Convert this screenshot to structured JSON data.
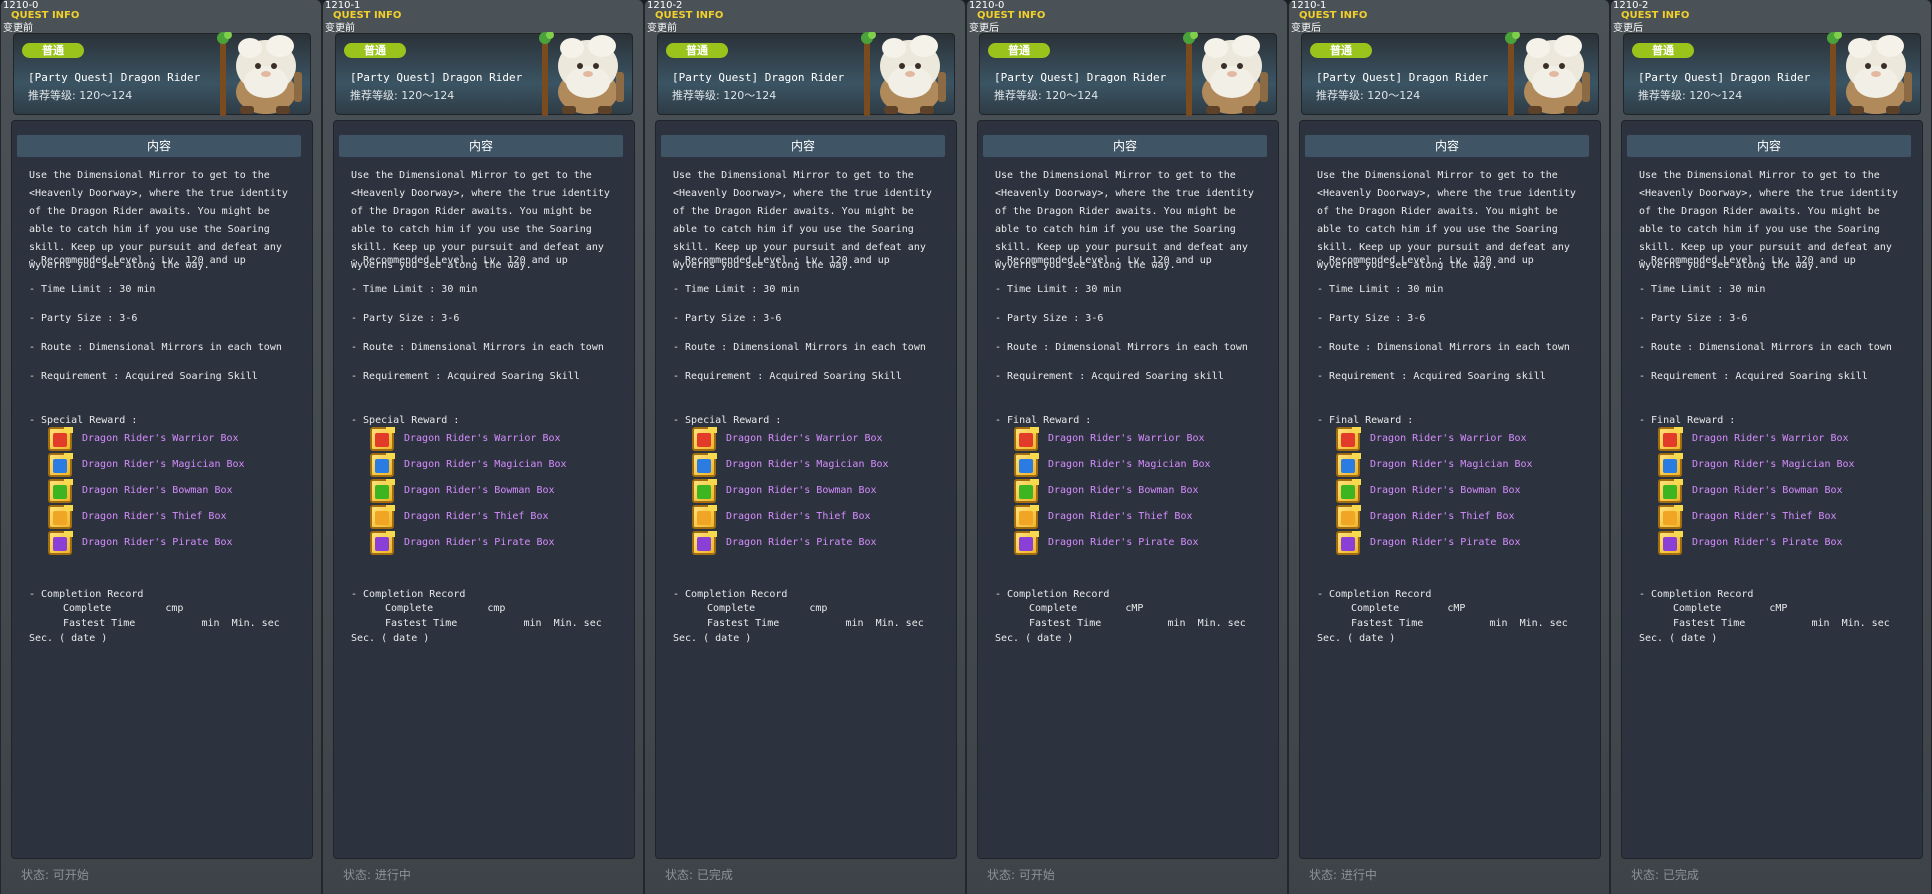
{
  "colors": {
    "panel_bg": "#454b50",
    "content_bg": "#2d333e",
    "content_header_bg": "#3f5566",
    "badge_bg": "#9ac41c",
    "title_yellow": "#f2d02c",
    "reward_link": "#d58cff",
    "status_text": "#8a9298",
    "box_warrior": "#e23b2a",
    "box_magician": "#2a7be2",
    "box_bowman": "#3cb521",
    "box_thief": "#f0a624",
    "box_pirate": "#8a3fd6"
  },
  "panels": [
    {
      "id": "1210-0",
      "title": "QUEST INFO",
      "subtitle": "变更前",
      "badge": "普通",
      "quest_name": "[Party Quest] Dragon Rider",
      "level": "推荐等级: 120～124",
      "section_header": "内容",
      "description": "Use the Dimensional Mirror to get to the\n<Heavenly Doorway>, where the true identity\nof the Dragon Rider awaits. You might be\nable to catch him if you use the Soaring\nskill. Keep up your pursuit and defeat any\nWyverns you see along the way.",
      "recommended_level": "- Recommended Level : Lv. 120 and up",
      "time_limit": "- Time Limit : 30 min",
      "party_size": "- Party Size : 3-6",
      "route": "- Route : Dimensional Mirrors in each town",
      "requirement": "- Requirement : Acquired Soaring Skill",
      "reward_heading": "- Special Reward :",
      "rewards": [
        {
          "icon": "warrior-box-icon",
          "label": "Dragon Rider's Warrior Box"
        },
        {
          "icon": "magician-box-icon",
          "label": "Dragon Rider's Magician Box"
        },
        {
          "icon": "bowman-box-icon",
          "label": "Dragon Rider's Bowman Box"
        },
        {
          "icon": "thief-box-icon",
          "label": "Dragon Rider's Thief Box"
        },
        {
          "icon": "pirate-box-icon",
          "label": "Dragon Rider's Pirate Box"
        }
      ],
      "record_heading": "- Completion Record",
      "record_complete": "Complete         cmp",
      "record_fastest": "Fastest Time           min  Min. sec",
      "record_date": "Sec. ( date )",
      "status": "状态:  可开始"
    },
    {
      "id": "1210-1",
      "title": "QUEST INFO",
      "subtitle": "变更前",
      "badge": "普通",
      "quest_name": "[Party Quest] Dragon Rider",
      "level": "推荐等级: 120～124",
      "section_header": "内容",
      "description": "Use the Dimensional Mirror to get to the\n<Heavenly Doorway>, where the true identity\nof the Dragon Rider awaits. You might be\nable to catch him if you use the Soaring\nskill. Keep up your pursuit and defeat any\nWyverns you see along the way.",
      "recommended_level": "- Recommended Level : Lv. 120 and up",
      "time_limit": "- Time Limit : 30 min",
      "party_size": "- Party Size : 3-6",
      "route": "- Route : Dimensional Mirrors in each town",
      "requirement": "- Requirement : Acquired Soaring Skill",
      "reward_heading": "- Special Reward :",
      "rewards": [
        {
          "icon": "warrior-box-icon",
          "label": "Dragon Rider's Warrior Box"
        },
        {
          "icon": "magician-box-icon",
          "label": "Dragon Rider's Magician Box"
        },
        {
          "icon": "bowman-box-icon",
          "label": "Dragon Rider's Bowman Box"
        },
        {
          "icon": "thief-box-icon",
          "label": "Dragon Rider's Thief Box"
        },
        {
          "icon": "pirate-box-icon",
          "label": "Dragon Rider's Pirate Box"
        }
      ],
      "record_heading": "- Completion Record",
      "record_complete": "Complete         cmp",
      "record_fastest": "Fastest Time           min  Min. sec",
      "record_date": "Sec. ( date )",
      "status": "状态:  进行中"
    },
    {
      "id": "1210-2",
      "title": "QUEST INFO",
      "subtitle": "变更前",
      "badge": "普通",
      "quest_name": "[Party Quest] Dragon Rider",
      "level": "推荐等级: 120～124",
      "section_header": "内容",
      "description": "Use the Dimensional Mirror to get to the\n<Heavenly Doorway>, where the true identity\nof the Dragon Rider awaits. You might be\nable to catch him if you use the Soaring\nskill. Keep up your pursuit and defeat any\nWyverns you see along the way.",
      "recommended_level": "- Recommended Level : Lv. 120 and up",
      "time_limit": "- Time Limit : 30 min",
      "party_size": "- Party Size : 3-6",
      "route": "- Route : Dimensional Mirrors in each town",
      "requirement": "- Requirement : Acquired Soaring Skill",
      "reward_heading": "- Special Reward :",
      "rewards": [
        {
          "icon": "warrior-box-icon",
          "label": "Dragon Rider's Warrior Box"
        },
        {
          "icon": "magician-box-icon",
          "label": "Dragon Rider's Magician Box"
        },
        {
          "icon": "bowman-box-icon",
          "label": "Dragon Rider's Bowman Box"
        },
        {
          "icon": "thief-box-icon",
          "label": "Dragon Rider's Thief Box"
        },
        {
          "icon": "pirate-box-icon",
          "label": "Dragon Rider's Pirate Box"
        }
      ],
      "record_heading": "- Completion Record",
      "record_complete": "Complete         cmp",
      "record_fastest": "Fastest Time           min  Min. sec",
      "record_date": "Sec. ( date )",
      "status": "状态:  已完成"
    },
    {
      "id": "1210-0",
      "title": "QUEST INFO",
      "subtitle": "变更后",
      "badge": "普通",
      "quest_name": "[Party Quest] Dragon Rider",
      "level": "推荐等级: 120～124",
      "section_header": "内容",
      "description": "Use the Dimensional Mirror to get to the\n<Heavenly Doorway>, where the true identity\nof the Dragon Rider awaits. You might be\nable to catch him if you use the Soaring\nskill. Keep up your pursuit and defeat any\nWyverns you see along the way.",
      "recommended_level": "- Recommended Level : Lv. 120 and up",
      "time_limit": "- Time Limit : 30 min",
      "party_size": "- Party Size : 3-6",
      "route": "- Route : Dimensional Mirrors in each town",
      "requirement": "- Requirement : Acquired Soaring skill",
      "reward_heading": "- Final Reward :",
      "rewards": [
        {
          "icon": "warrior-box-icon",
          "label": "Dragon Rider's Warrior Box"
        },
        {
          "icon": "magician-box-icon",
          "label": "Dragon Rider's Magician Box"
        },
        {
          "icon": "bowman-box-icon",
          "label": "Dragon Rider's Bowman Box"
        },
        {
          "icon": "thief-box-icon",
          "label": "Dragon Rider's Thief Box"
        },
        {
          "icon": "pirate-box-icon",
          "label": "Dragon Rider's Pirate Box"
        }
      ],
      "record_heading": "- Completion Record",
      "record_complete": "Complete        cMP",
      "record_fastest": "Fastest Time           min  Min. sec",
      "record_date": "Sec. ( date )",
      "status": "状态:  可开始"
    },
    {
      "id": "1210-1",
      "title": "QUEST INFO",
      "subtitle": "变更后",
      "badge": "普通",
      "quest_name": "[Party Quest] Dragon Rider",
      "level": "推荐等级: 120～124",
      "section_header": "内容",
      "description": "Use the Dimensional Mirror to get to the\n<Heavenly Doorway>, where the true identity\nof the Dragon Rider awaits. You might be\nable to catch him if you use the Soaring\nskill. Keep up your pursuit and defeat any\nWyverns you see along the way.",
      "recommended_level": "- Recommended Level : Lv. 120 and up",
      "time_limit": "- Time Limit : 30 min",
      "party_size": "- Party Size : 3-6",
      "route": "- Route : Dimensional Mirrors in each town",
      "requirement": "- Requirement : Acquired Soaring skill",
      "reward_heading": "- Final Reward :",
      "rewards": [
        {
          "icon": "warrior-box-icon",
          "label": "Dragon Rider's Warrior Box"
        },
        {
          "icon": "magician-box-icon",
          "label": "Dragon Rider's Magician Box"
        },
        {
          "icon": "bowman-box-icon",
          "label": "Dragon Rider's Bowman Box"
        },
        {
          "icon": "thief-box-icon",
          "label": "Dragon Rider's Thief Box"
        },
        {
          "icon": "pirate-box-icon",
          "label": "Dragon Rider's Pirate Box"
        }
      ],
      "record_heading": "- Completion Record",
      "record_complete": "Complete        cMP",
      "record_fastest": "Fastest Time           min  Min. sec",
      "record_date": "Sec. ( date )",
      "status": "状态:  进行中"
    },
    {
      "id": "1210-2",
      "title": "QUEST INFO",
      "subtitle": "变更后",
      "badge": "普通",
      "quest_name": "[Party Quest] Dragon Rider",
      "level": "推荐等级: 120～124",
      "section_header": "内容",
      "description": "Use the Dimensional Mirror to get to the\n<Heavenly Doorway>, where the true identity\nof the Dragon Rider awaits. You might be\nable to catch him if you use the Soaring\nskill. Keep up your pursuit and defeat any\nWyverns you see along the way.",
      "recommended_level": "- Recommended Level : Lv. 120 and up",
      "time_limit": "- Time Limit : 30 min",
      "party_size": "- Party Size : 3-6",
      "route": "- Route : Dimensional Mirrors in each town",
      "requirement": "- Requirement : Acquired Soaring skill",
      "reward_heading": "- Final Reward :",
      "rewards": [
        {
          "icon": "warrior-box-icon",
          "label": "Dragon Rider's Warrior Box"
        },
        {
          "icon": "magician-box-icon",
          "label": "Dragon Rider's Magician Box"
        },
        {
          "icon": "bowman-box-icon",
          "label": "Dragon Rider's Bowman Box"
        },
        {
          "icon": "thief-box-icon",
          "label": "Dragon Rider's Thief Box"
        },
        {
          "icon": "pirate-box-icon",
          "label": "Dragon Rider's Pirate Box"
        }
      ],
      "record_heading": "- Completion Record",
      "record_complete": "Complete        cMP",
      "record_fastest": "Fastest Time           min  Min. sec",
      "record_date": "Sec. ( date )",
      "status": "状态:  已完成"
    }
  ]
}
